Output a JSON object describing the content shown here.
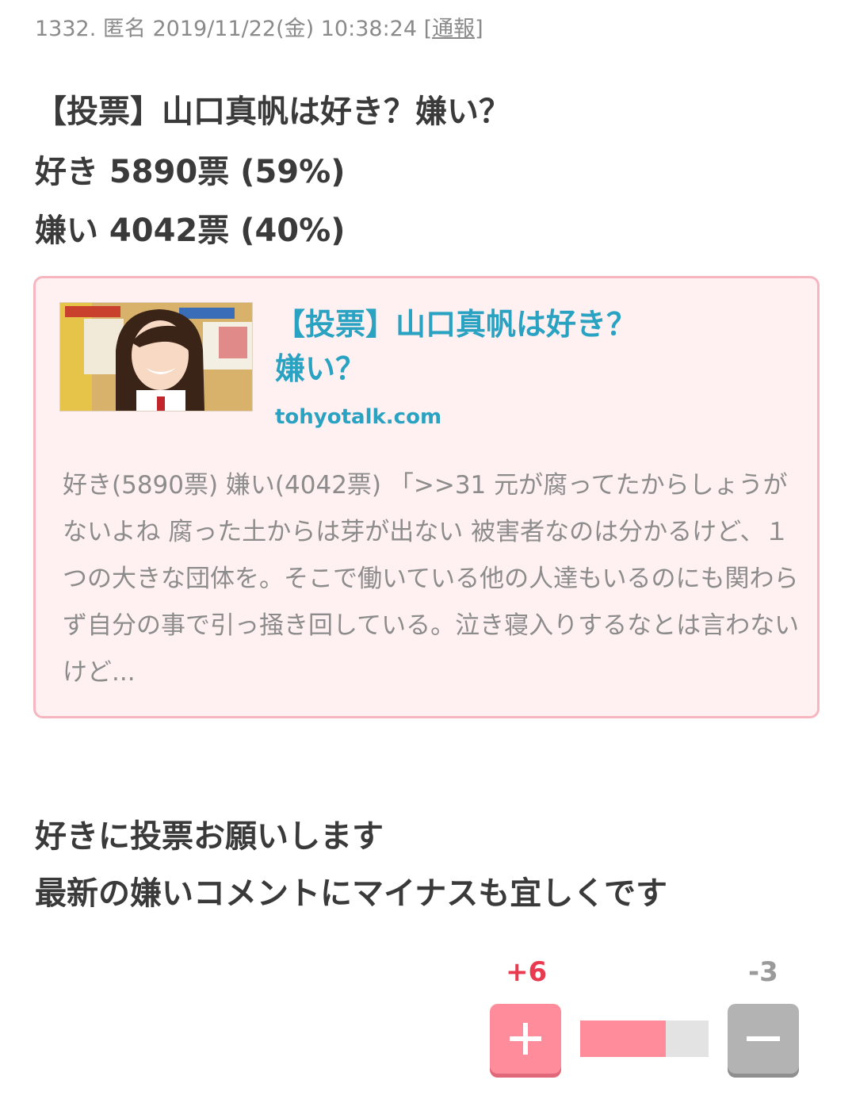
{
  "post": {
    "number": "1332.",
    "author": "匿名",
    "datetime": "2019/11/22(金) 10:38:24",
    "report_label": "[通報]",
    "lines": [
      "【投票】山口真帆は好き？嫌い？",
      "好き 5890票 (59%)",
      "嫌い 4042票 (40%)"
    ]
  },
  "link_card": {
    "title_line1": "【投票】山口真帆は好き？",
    "title_line2": "嫌い？",
    "domain": "tohyotalk.com",
    "description": "好き(5890票) 嫌い(4042票) 「>>31 元が腐ってたからしょうがないよね 腐った土からは芽が出ない 被害者なのは分かるけど、１つの大きな団体を。そこで働いている他の人達もいるのにも関わらず自分の事で引っ掻き回している。泣き寝入りするなとは言わないけど...",
    "thumbnail_icon": "photo-thumbnail"
  },
  "message": {
    "line1": "好きに投票お願いします",
    "line2": "最新の嫌いコメントにマイナスも宜しくです"
  },
  "votes": {
    "plus_count": "+6",
    "minus_count": "-3",
    "plus_ratio": 0.6667,
    "plus_icon": "plus-icon",
    "minus_icon": "minus-icon",
    "colors": {
      "plus": "#ff8c9b",
      "minus": "#b3b3b3",
      "plus_text": "#ea3a4f",
      "link": "#2aa3c2"
    }
  }
}
